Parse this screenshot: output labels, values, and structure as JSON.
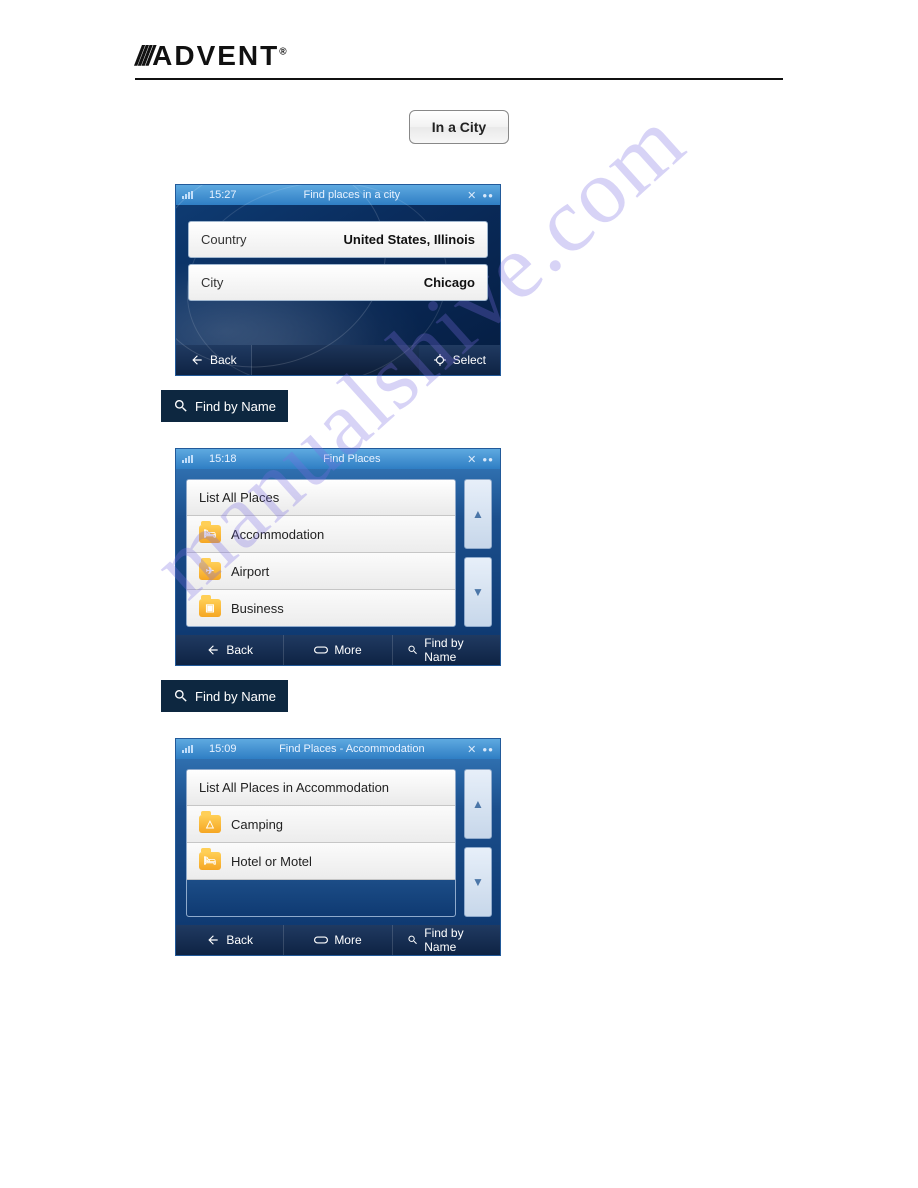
{
  "brand": "ADVENT",
  "watermark": "manualshive.com",
  "in_a_city_btn": "In a City",
  "find_by_name_chip": "Find by Name",
  "screen1": {
    "time": "15:27",
    "title": "Find places in a city",
    "rows": [
      {
        "label": "Country",
        "value": "United States, Illinois"
      },
      {
        "label": "City",
        "value": "Chicago"
      }
    ],
    "footer": {
      "back": "Back",
      "select": "Select"
    }
  },
  "screen2": {
    "time": "15:18",
    "title": "Find Places",
    "header": "List All Places",
    "items": [
      {
        "label": "Accommodation"
      },
      {
        "label": "Airport"
      },
      {
        "label": "Business"
      }
    ],
    "footer": {
      "back": "Back",
      "more": "More",
      "find": "Find by Name"
    }
  },
  "screen3": {
    "time": "15:09",
    "title": "Find Places - Accommodation",
    "header": "List All Places in Accommodation",
    "items": [
      {
        "label": "Camping"
      },
      {
        "label": "Hotel or Motel"
      }
    ],
    "footer": {
      "back": "Back",
      "more": "More",
      "find": "Find by Name"
    }
  }
}
